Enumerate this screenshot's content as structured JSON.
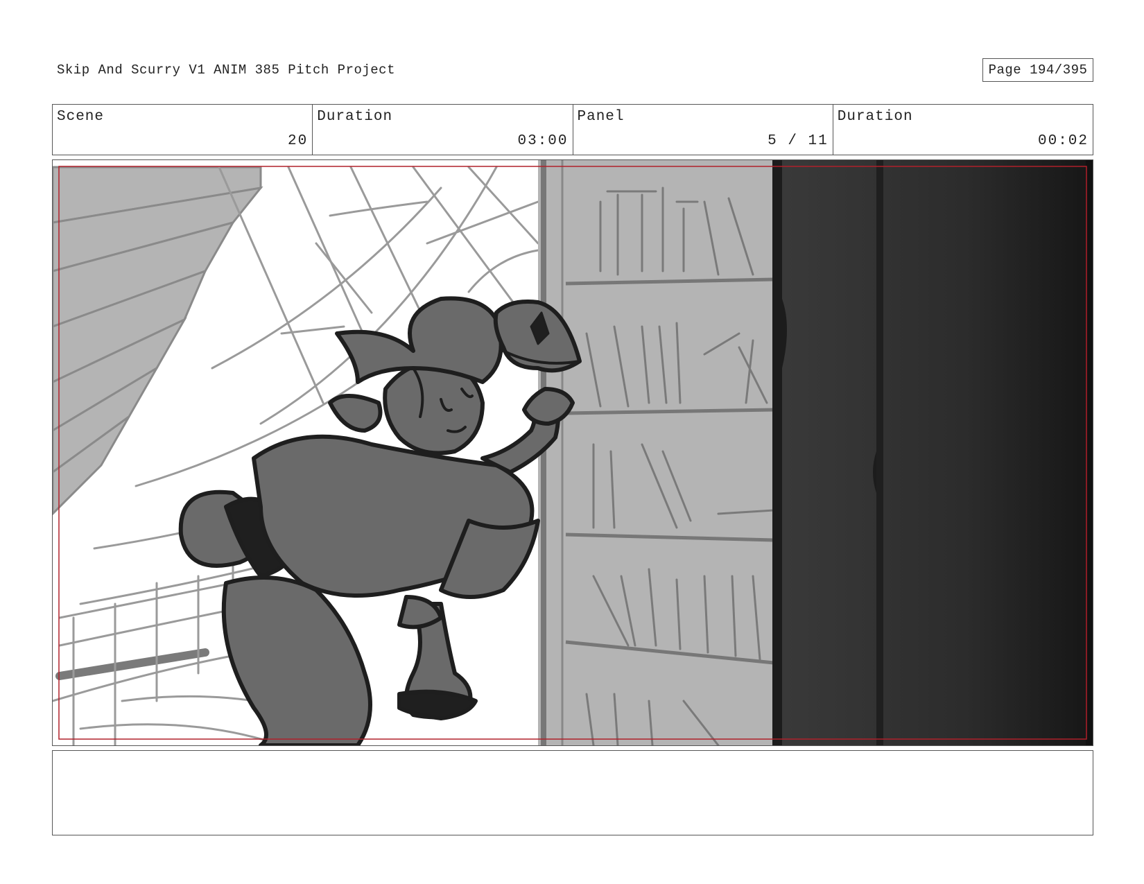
{
  "header": {
    "title": "Skip And Scurry V1  ANIM 385 Pitch Project",
    "page": "Page 194/395"
  },
  "info": {
    "scene_label": "Scene",
    "scene_value": "20",
    "scene_duration_label": "Duration",
    "scene_duration_value": "03:00",
    "panel_label": "Panel",
    "panel_value": "5 / 11",
    "panel_duration_label": "Duration",
    "panel_duration_value": "00:02"
  },
  "frame": {
    "safe_area_color": "#b0202a"
  },
  "notes": {
    "text": ""
  }
}
